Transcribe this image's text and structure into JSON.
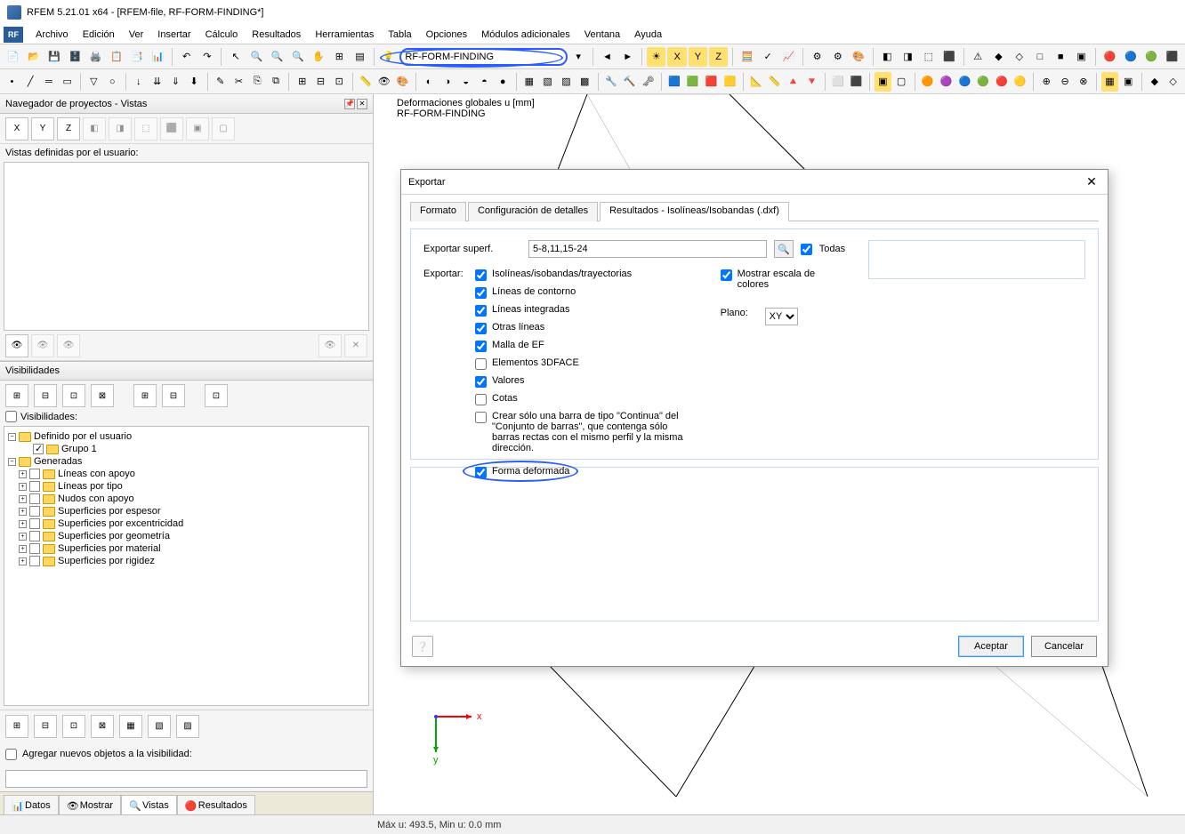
{
  "title": "RFEM 5.21.01 x64 - [RFEM-file, RF-FORM-FINDING*]",
  "menus": [
    "Archivo",
    "Edición",
    "Ver",
    "Insertar",
    "Cálculo",
    "Resultados",
    "Herramientas",
    "Tabla",
    "Opciones",
    "Módulos adicionales",
    "Ventana",
    "Ayuda"
  ],
  "toolbar_combo": "RF-FORM-FINDING",
  "navigator": {
    "title": "Navegador de proyectos - Vistas",
    "user_views_label": "Vistas definidas por el usuario:",
    "visibilities_header": "Visibilidades",
    "visibilities_check": "Visibilidades:",
    "tree": {
      "user_defined": "Definido por el usuario",
      "group1": "Grupo 1",
      "generated": "Generadas",
      "items": [
        "Líneas con apoyo",
        "Líneas por tipo",
        "Nudos con apoyo",
        "Superficies por espesor",
        "Superficies por excentricidad",
        "Superficies por geometría",
        "Superficies por material",
        "Superficies por rigidez"
      ]
    },
    "add_label": "Agregar nuevos objetos a la visibilidad:",
    "tabs": [
      "Datos",
      "Mostrar",
      "Vistas",
      "Resultados"
    ]
  },
  "viewport": {
    "line1": "Deformaciones globales u [mm]",
    "line2": "RF-FORM-FINDING",
    "axis_x": "x",
    "axis_y": "y"
  },
  "dialog": {
    "title": "Exportar",
    "tabs": [
      "Formato",
      "Configuración de detalles",
      "Resultados - Isolíneas/Isobandas (.dxf)"
    ],
    "active_tab": 2,
    "export_surf_label": "Exportar superf.",
    "export_surf_value": "5-8,11,15-24",
    "all_label": "Todas",
    "export_label": "Exportar:",
    "options": {
      "iso": "Isolíneas/isobandas/trayectorias",
      "contorno": "Líneas de contorno",
      "integradas": "Líneas integradas",
      "otras": "Otras líneas",
      "malla": "Malla de EF",
      "e3dface": "Elementos 3DFACE",
      "valores": "Valores",
      "cotas": "Cotas",
      "continua": "Crear sólo una barra de tipo \"Continua\" del \"Conjunto de barras\", que contenga sólo barras rectas con el mismo perfil y la misma dirección.",
      "deformada": "Forma deformada"
    },
    "show_scale": "Mostrar escala de colores",
    "plane_label": "Plano:",
    "plane_value": "XY",
    "ok": "Aceptar",
    "cancel": "Cancelar"
  },
  "status": {
    "right": "Máx u: 493.5, Min u: 0.0 mm"
  }
}
